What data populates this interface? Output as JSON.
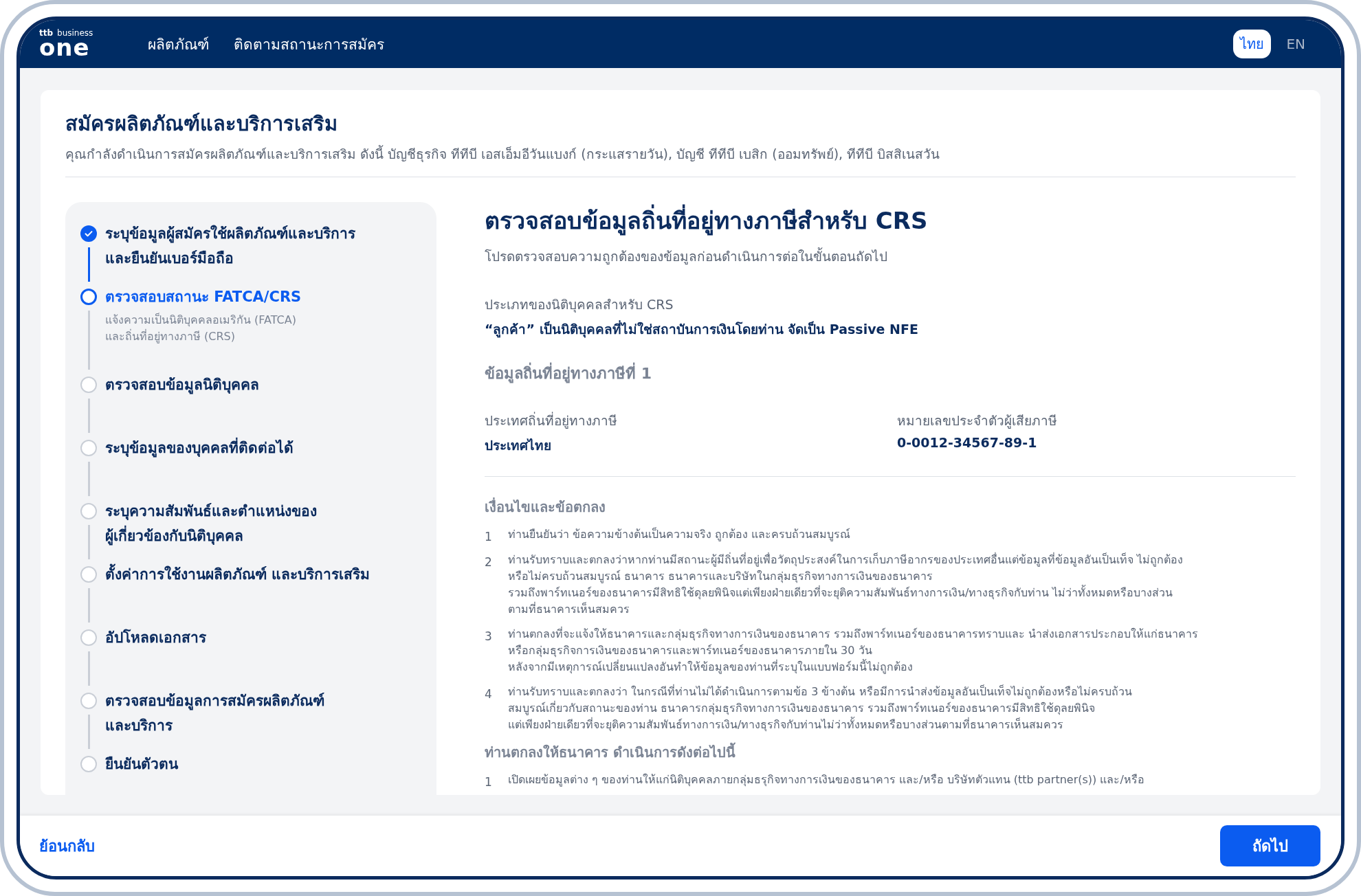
{
  "header": {
    "logo": {
      "small_left": "ttb",
      "small_right": "business",
      "main": "one"
    },
    "nav": [
      "ผลิตภัณฑ์",
      "ติดตามสถานะการสมัคร"
    ],
    "languages": [
      {
        "label": "ไทย",
        "selected": true
      },
      {
        "label": "EN",
        "selected": false
      }
    ]
  },
  "page": {
    "title": "สมัครผลิตภัณฑ์และบริการเสริม",
    "subtitle": "คุณกำลังดำเนินการสมัครผลิตภัณฑ์และบริการเสริม ดังนี้  บัญชีธุรกิจ ทีทีบี เอสเอ็มอีวันแบงก์ (กระแสรายวัน),  บัญชี ทีทีบี เบสิก (ออมทรัพย์),  ทีทีบี บิสสิเนสวัน"
  },
  "steps": [
    {
      "lines": [
        "ระบุข้อมูลผู้สมัครใช้ผลิตภัณฑ์และบริการ",
        "และยืนยันเบอร์มือถือ"
      ],
      "done": true,
      "current": false
    },
    {
      "lines": [
        "ตรวจสอบสถานะ FATCA/CRS"
      ],
      "done": false,
      "current": true,
      "description": [
        "แจ้งความเป็นนิติบุคคลอเมริกัน (FATCA)",
        "และถิ่นที่อยู่ทางภาษี (CRS)"
      ]
    },
    {
      "lines": [
        "ตรวจสอบข้อมูลนิติบุคคล"
      ],
      "done": false,
      "current": false
    },
    {
      "lines": [
        "ระบุข้อมูลของบุคคลที่ติดต่อได้"
      ],
      "done": false,
      "current": false
    },
    {
      "lines": [
        "ระบุความสัมพันธ์และตำแหน่งของ",
        "ผู้เกี่ยวข้องกับนิติบุคคล"
      ],
      "done": false,
      "current": false
    },
    {
      "lines": [
        "ตั้งค่าการใช้งานผลิตภัณฑ์ และบริการเสริม"
      ],
      "done": false,
      "current": false
    },
    {
      "lines": [
        "อัปโหลดเอกสาร"
      ],
      "done": false,
      "current": false
    },
    {
      "lines": [
        "ตรวจสอบข้อมูลการสมัครผลิตภัณฑ์",
        "และบริการ"
      ],
      "done": false,
      "current": false
    },
    {
      "lines": [
        "ยืนยันตัวตน"
      ],
      "done": false,
      "current": false
    }
  ],
  "content": {
    "title": "ตรวจสอบข้อมูลถิ่นที่อยู่ทางภาษีสำหรับ CRS",
    "subtitle": "โปรดตรวจสอบความถูกต้องของข้อมูลก่อนดำเนินการต่อในขั้นตอนถัดไป",
    "entity_type": {
      "label": "ประเภทของนิติบุคคลสำหรับ CRS",
      "value": "“ลูกค้า” เป็นนิติบุคคลที่ไม่ใช่สถาบันการเงินโดยท่าน จัดเป็น Passive NFE"
    },
    "residence_heading": "ข้อมูลถิ่นที่อยู่ทางภาษีที่ 1",
    "fields": [
      {
        "label": "ประเทศถิ่นที่อยู่ทางภาษี",
        "value": "ประเทศไทย"
      },
      {
        "label": "หมายเลขประจำตัวผู้เสียภาษี",
        "value": "0-0012-34567-89-1"
      }
    ],
    "sections": [
      {
        "heading": "เงื่อนไขและข้อตกลง",
        "items": [
          {
            "number": "1",
            "lines": [
              "ท่านยืนยันว่า ข้อความข้างต้นเป็นความจริง ถูกต้อง และครบถ้วนสมบูรณ์"
            ]
          },
          {
            "number": "2",
            "lines": [
              "ท่านรับทราบและตกลงว่าหากท่านมีสถานะผู้มีถิ่นที่อยู่เพื่อวัตถุประสงค์ในการเก็บภาษีอากรของประเทศอื่นแต่ข้อมูลที่ข้อมูลอันเป็นเท็จ ไม่ถูกต้อง",
              "หรือไม่ครบถ้วนสมบูรณ์ ธนาคาร ธนาคารและบริษัทในกลุ่มธุรกิจทางการเงินของธนาคาร",
              "รวมถึงพาร์ทเนอร์ของธนาคารมีสิทธิใช้ดุลยพินิจแต่เพียงฝ่ายเดียวที่จะยุติความสัมพันธ์ทางการเงิน/ทางธุรกิจกับท่าน ไม่ว่าทั้งหมดหรือบางส่วน",
              "ตามที่ธนาคารเห็นสมควร"
            ]
          },
          {
            "number": "3",
            "lines": [
              "ท่านตกลงที่จะแจ้งให้ธนาคารและกลุ่มธุรกิจทางการเงินของธนาคาร รวมถึงพาร์ทเนอร์ของธนาคารทราบและ นำส่งเอกสารประกอบให้แก่ธนาคาร",
              "หรือกลุ่มธุรกิจการเงินของธนาคารและพาร์ทเนอร์ของธนาคารภายใน 30 วัน",
              "หลังจากมีเหตุการณ์เปลี่ยนแปลงอันทำให้ข้อมูลของท่านที่ระบุในแบบฟอร์มนี้ไม่ถูกต้อง"
            ]
          },
          {
            "number": "4",
            "lines": [
              "ท่านรับทราบและตกลงว่า ในกรณีที่ท่านไม่ได้ดำเนินการตามข้อ 3 ข้างต้น หรือมีการนำส่งข้อมูลอันเป็นเท็จไม่ถูกต้องหรือไม่ครบถ้วน",
              "สมบูรณ์เกี่ยวกับสถานะของท่าน ธนาคารกลุ่มธุรกิจทางการเงินของธนาคาร รวมถึงพาร์ทเนอร์ของธนาคารมีสิทธิใช้ดุลยพินิจ",
              "แต่เพียงฝ่ายเดียวที่จะยุติความสัมพันธ์ทางการเงิน/ทางธุรกิจกับท่านไม่ว่าทั้งหมดหรือบางส่วนตามที่ธนาคารเห็นสมควร"
            ]
          }
        ]
      },
      {
        "heading": "ท่านตกลงให้ธนาคาร ดำเนินการดังต่อไปนี้",
        "items": [
          {
            "number": "1",
            "lines": [
              "เปิดเผยข้อมูลต่าง ๆ ของท่านให้แก่นิติบุคคลภายกลุ่มธรุกิจทางการเงินของธนาคาร และ/หรือ บริษัทตัวแทน (ttb partner(s)) และ/หรือ"
            ]
          }
        ]
      }
    ]
  },
  "footer": {
    "back": "ย้อนกลับ",
    "next": "ถัดไป"
  }
}
